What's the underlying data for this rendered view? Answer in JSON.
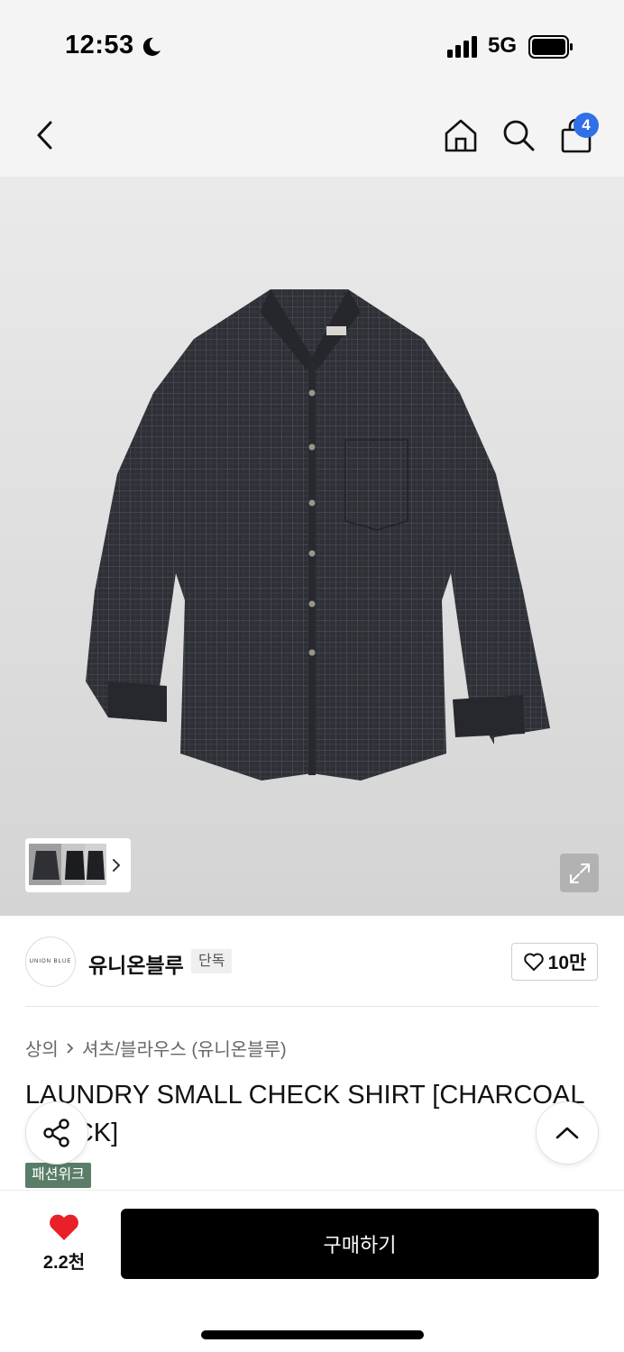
{
  "status": {
    "time": "12:53",
    "network": "5G"
  },
  "nav": {
    "back_icon": "chevron-left-icon",
    "home_icon": "home-icon",
    "search_icon": "search-icon",
    "cart_icon": "shopping-bag-icon",
    "cart_badge": "4",
    "badge_color": "#2f6fe8"
  },
  "hero": {
    "product_image": "charcoal check shirt",
    "expand_icon": "expand-icon"
  },
  "brand": {
    "logo_text": "UNION BLUE",
    "name": "유니온블루",
    "tag": "단독",
    "like_count": "10만"
  },
  "breadcrumb": {
    "category": "상의",
    "subcategory": "셔츠/블라우스 (유니온블루)"
  },
  "product": {
    "title": "LAUNDRY SMALL CHECK SHIRT [CHARCOAL BLACK]",
    "season_tag": "패션위크",
    "season_tag_color": "#5a7d68"
  },
  "bottom": {
    "wish_count": "2.2천",
    "buy_label": "구매하기",
    "heart_color": "#e8202a"
  }
}
